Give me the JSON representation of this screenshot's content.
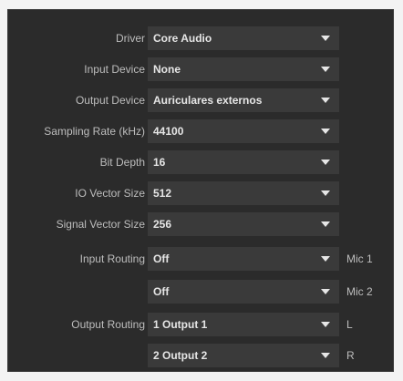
{
  "settings": [
    {
      "label": "Driver",
      "value": "Core Audio",
      "suffix": ""
    },
    {
      "label": "Input Device",
      "value": "None",
      "suffix": ""
    },
    {
      "label": "Output Device",
      "value": "Auriculares externos",
      "suffix": ""
    },
    {
      "label": "Sampling Rate (kHz)",
      "value": "44100",
      "suffix": ""
    },
    {
      "label": "Bit Depth",
      "value": "16",
      "suffix": ""
    },
    {
      "label": "IO Vector Size",
      "value": "512",
      "suffix": ""
    },
    {
      "label": "Signal Vector Size",
      "value": "256",
      "suffix": ""
    },
    {
      "label": "Input Routing",
      "value": "Off",
      "suffix": "Mic 1"
    },
    {
      "label": "",
      "value": "Off",
      "suffix": "Mic 2"
    },
    {
      "label": "Output Routing",
      "value": "1 Output 1",
      "suffix": "L"
    },
    {
      "label": "",
      "value": "2 Output 2",
      "suffix": "R"
    }
  ],
  "colors": {
    "panel_bg": "#2b2b2b",
    "select_bg": "#3a3a3a",
    "label_text": "#bdbdbd",
    "value_text": "#e6e6e6"
  },
  "icons": {
    "dropdown": "triangle-down-icon"
  }
}
